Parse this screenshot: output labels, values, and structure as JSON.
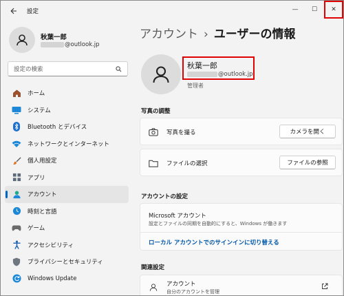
{
  "window": {
    "title": "設定",
    "controls": {
      "minimize": "—",
      "maximize": "☐",
      "close": "✕"
    },
    "accent": "#0067c0",
    "highlight": "#e00000"
  },
  "sidebar": {
    "user_name": "秋葉一郎",
    "user_email_domain": "@outlook.jp",
    "search_placeholder": "設定の検索",
    "items": [
      {
        "label": "ホーム",
        "icon": "home-icon"
      },
      {
        "label": "システム",
        "icon": "system-icon"
      },
      {
        "label": "Bluetooth とデバイス",
        "icon": "bluetooth-icon"
      },
      {
        "label": "ネットワークとインターネット",
        "icon": "network-icon"
      },
      {
        "label": "個人用設定",
        "icon": "brush-icon"
      },
      {
        "label": "アプリ",
        "icon": "apps-icon"
      },
      {
        "label": "アカウント",
        "icon": "account-icon",
        "active": true
      },
      {
        "label": "時刻と言語",
        "icon": "time-language-icon"
      },
      {
        "label": "ゲーム",
        "icon": "gaming-icon"
      },
      {
        "label": "アクセシビリティ",
        "icon": "accessibility-icon"
      },
      {
        "label": "プライバシーとセキュリティ",
        "icon": "shield-icon"
      },
      {
        "label": "Windows Update",
        "icon": "update-icon"
      }
    ]
  },
  "main": {
    "breadcrumb_parent": "アカウント",
    "breadcrumb_separator": "›",
    "page_title": "ユーザーの情報",
    "profile": {
      "name": "秋葉一郎",
      "email_domain": "@outlook.jp",
      "role": "管理者"
    },
    "photo_section": {
      "heading": "写真の調整",
      "rows": [
        {
          "label": "写真を撮る",
          "button": "カメラを開く",
          "icon": "camera-icon"
        },
        {
          "label": "ファイルの選択",
          "button": "ファイルの参照",
          "icon": "folder-icon"
        }
      ]
    },
    "account_section": {
      "heading": "アカウントの設定",
      "title": "Microsoft アカウント",
      "description": "設定とファイルの同期を自動的にすると、Windows が働きます",
      "link": "ローカル アカウントでのサインインに切り替える"
    },
    "related_section": {
      "heading": "関連設定",
      "title": "アカウント",
      "description": "自分のアカウントを管理"
    }
  }
}
